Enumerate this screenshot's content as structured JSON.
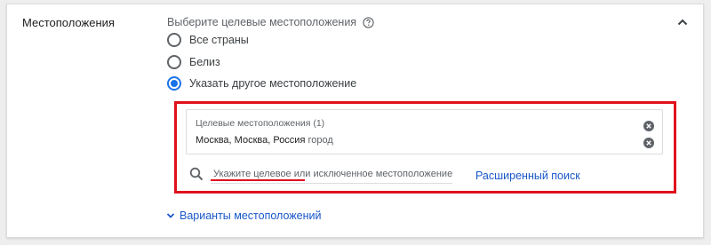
{
  "section": {
    "title": "Местоположения"
  },
  "prompt": {
    "text": "Выберите целевые местоположения"
  },
  "radio_options": [
    {
      "label": "Все страны",
      "checked": false
    },
    {
      "label": "Белиз",
      "checked": false
    },
    {
      "label": "Указать другое местоположение",
      "checked": true
    }
  ],
  "targets": {
    "title": "Целевые местоположения (1)",
    "item_name": "Москва, Москва, Россия",
    "item_type": "город"
  },
  "search": {
    "placeholder": "Укажите целевое или исключенное местоположение"
  },
  "advanced_search": {
    "label": "Расширенный поиск"
  },
  "variants": {
    "label": "Варианты местоположений"
  },
  "colors": {
    "accent": "#1a73e8",
    "link": "#1a57c9",
    "highlight": "#e0101d"
  },
  "icons": {
    "collapse": "chevron-up-icon",
    "help": "help-circle-icon",
    "clear": "close-circle-icon",
    "search": "search-icon",
    "expand": "chevron-down-icon"
  }
}
